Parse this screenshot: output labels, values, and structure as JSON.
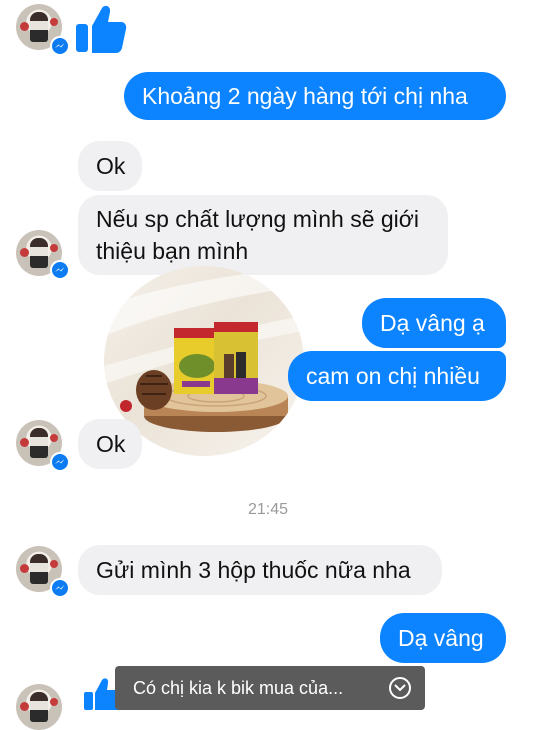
{
  "messages": {
    "m1": "Khoảng 2 ngày hàng tới chị nha",
    "m2": "Ok",
    "m3_line1": "Nếu sp chất lượng mình sẽ giới",
    "m3_line2": "thiệu bạn mình",
    "m4": "Dạ vâng ạ",
    "m5": "cam on chị nhiều",
    "m6": "Ok",
    "m7": "Gửi mình 3 hộp thuốc nữa nha",
    "m8": "Dạ vâng"
  },
  "timestamp": "21:45",
  "toast": {
    "text": "Có chị kia k bik mua của...",
    "icon": "chevron-down-icon"
  },
  "colors": {
    "outgoing_bubble": "#0d84ff",
    "incoming_bubble": "#f0f0f2",
    "like_icon": "#0d84ff",
    "toast_bg": "#5b5b5b"
  }
}
